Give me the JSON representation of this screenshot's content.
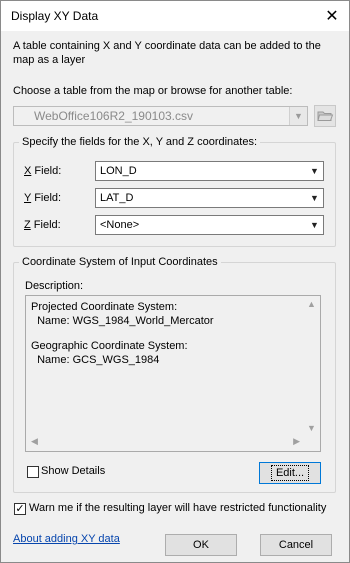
{
  "window": {
    "title": "Display XY Data",
    "close_glyph": "✕"
  },
  "intro_text": "A table containing X and Y coordinate data can be added to the map as a layer",
  "table": {
    "label": "Choose a table from the map or browse for another table:",
    "selected": "WebOffice106R2_190103.csv",
    "browse_icon": "folder-open-icon"
  },
  "fields_group": {
    "title": "Specify the fields for the X, Y and Z coordinates:",
    "x": {
      "label_key": "X",
      "label_rest": " Field:",
      "value": "LON_D"
    },
    "y": {
      "label_key": "Y",
      "label_rest": " Field:",
      "value": "LAT_D"
    },
    "z": {
      "label_key": "Z",
      "label_rest": " Field:",
      "value": "<None>"
    }
  },
  "coord_group": {
    "title": "Coordinate System of Input Coordinates",
    "description_label": "Description:",
    "description_lines": [
      "Projected Coordinate System:",
      "  Name: WGS_1984_World_Mercator",
      "",
      "Geographic Coordinate System:",
      "  Name: GCS_WGS_1984"
    ],
    "show_details_label": "Show Details",
    "show_details_checked": false,
    "edit_button": "Edit..."
  },
  "warn": {
    "checked": true,
    "label": "Warn me if the resulting layer will have restricted functionality"
  },
  "footer": {
    "help_link": "About adding XY data",
    "ok": "OK",
    "cancel": "Cancel"
  }
}
